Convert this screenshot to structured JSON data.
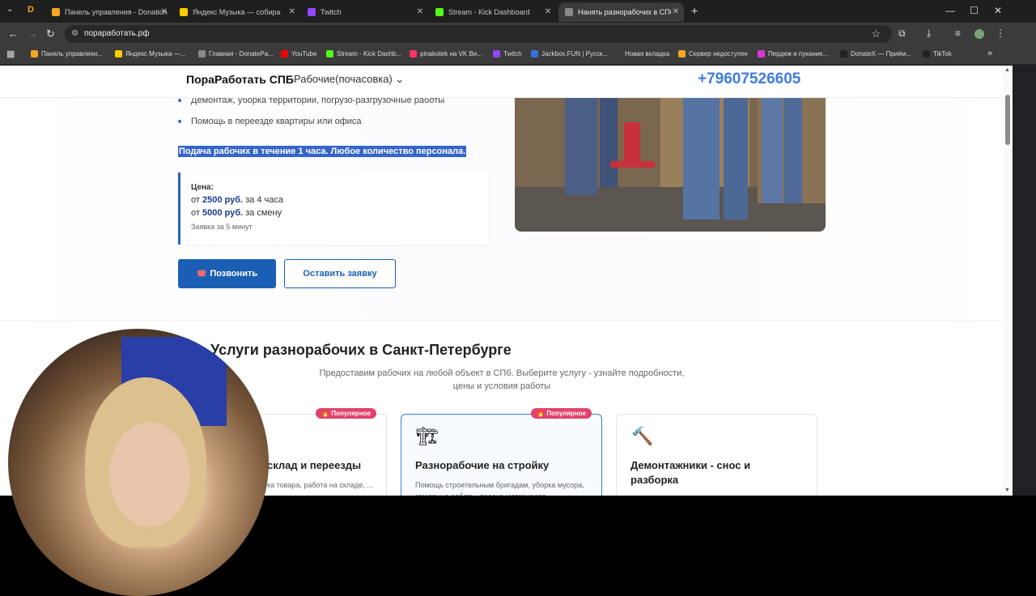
{
  "browser": {
    "tabs": [
      {
        "label": "Панель управления - Donation",
        "color": "#f5a623"
      },
      {
        "label": "Яндекс Музыка — собира",
        "color": "#ffcc00"
      },
      {
        "label": "Twitch",
        "color": "#9146ff"
      },
      {
        "label": "Stream - Kick Dashboard",
        "color": "#53fc18"
      },
      {
        "label": "Нанять разнорабочих в СПб с",
        "color": "#888888"
      }
    ],
    "new_tab": "+",
    "url": "порaработать.рф",
    "bookmarks": [
      {
        "label": "Панель управлени...",
        "color": "#f5a623"
      },
      {
        "label": "Яндекс Музыка —...",
        "color": "#ffcc00"
      },
      {
        "label": "Главная - DonatePa...",
        "color": "#888888"
      },
      {
        "label": "YouTube",
        "color": "#ff0000"
      },
      {
        "label": "Stream - Kick Dashb...",
        "color": "#53fc18"
      },
      {
        "label": "pinakotek на VK Ви...",
        "color": "#ff3366"
      },
      {
        "label": "Twitch",
        "color": "#9146ff"
      },
      {
        "label": "Jackbox.FUN | Русск...",
        "color": "#3a6fd8"
      },
      {
        "label": "Новая вкладка",
        "color": "#3b3b3b"
      },
      {
        "label": "Сервер недоступен",
        "color": "#f5a623"
      },
      {
        "label": "Пердеж и пукание...",
        "color": "#d83ad8"
      },
      {
        "label": "DonateX — Приём...",
        "color": "#222222"
      },
      {
        "label": "TikTok",
        "color": "#222222"
      }
    ]
  },
  "header": {
    "brand": "ПораРаботать СПБ",
    "menu": "Рабочие(почасовка) ⌄",
    "phone": "+79607526605"
  },
  "hero": {
    "bullets": [
      "Демонтаж, уборка территории, погрузо-разгрузочные работы",
      "Помощь в переезде квартиры или офиса"
    ],
    "highlight": "Подача рабочих в течение 1 часа. Любое количество персонала.",
    "price": {
      "label": "Цена:",
      "row1_prefix": "от",
      "row1_value": "2500 руб.",
      "row1_suffix": "за 4 часа",
      "row2_prefix": "от",
      "row2_value": "5000 руб.",
      "row2_suffix": "за смену",
      "note": "Заявка за 5 минут"
    },
    "call_button": "Позвонить",
    "order_button": "Оставить заявку"
  },
  "services": {
    "title": "Услуги разнорабочих в Санкт-Петербурге",
    "subtitle": "Предоставим рабочих на любой объект в СПб. Выберите услугу - узнайте подробности, цены и условия работы",
    "cards": [
      {
        "title": "склад и переезды",
        "desc": "ка товара, работа на складе, ...",
        "badge": "🔥 Популярное",
        "icon": "📦"
      },
      {
        "title": "Разнорабочие на стройку",
        "desc": "Помощь строительным бригадам, уборка мусора, земляные работы, подача материалов",
        "badge": "🔥 Популярное",
        "icon": "🏗"
      },
      {
        "title": "Демонтажники - снос и разборка",
        "desc": "",
        "badge": "",
        "icon": "🔨"
      }
    ]
  },
  "colors": {
    "accent": "#1a5fb4",
    "phone": "#3f7ddf",
    "badge": "#e0436d"
  }
}
